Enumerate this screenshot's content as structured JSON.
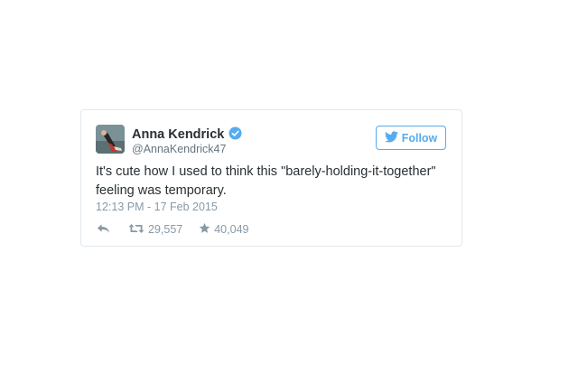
{
  "tweet": {
    "user": {
      "name": "Anna Kendrick",
      "handle": "@AnnaKendrick47",
      "verified": true,
      "avatar_icon": "profile-photo"
    },
    "follow_button": {
      "label": "Follow",
      "icon": "twitter-bird-icon"
    },
    "text": "It's cute how I used to think this \"barely-holding-it-together\" feeling was temporary.",
    "timestamp": "12:13 PM - 17 Feb 2015",
    "actions": {
      "reply_icon": "reply-icon",
      "retweet_icon": "retweet-icon",
      "retweet_count": "29,557",
      "favorite_icon": "star-icon",
      "favorite_count": "40,049"
    }
  },
  "colors": {
    "accent": "#55acee",
    "text": "#292f33",
    "muted": "#8899a6",
    "border": "#e1e8ed"
  }
}
